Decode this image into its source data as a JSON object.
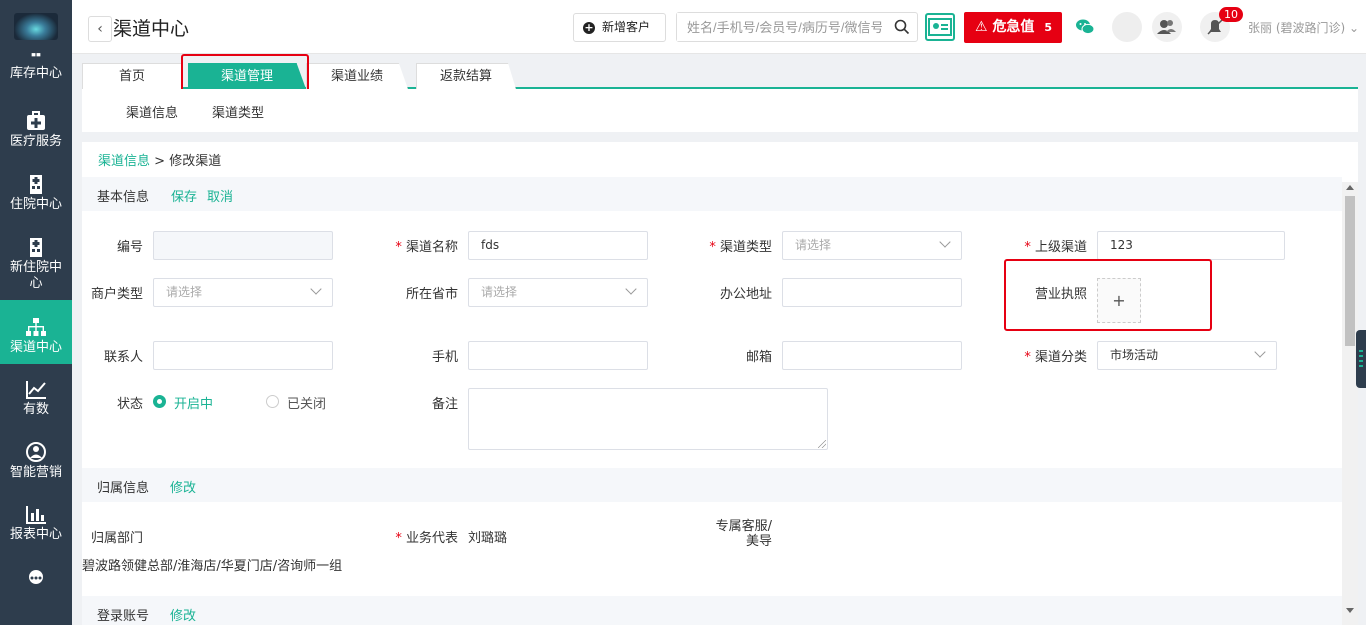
{
  "sidebar": {
    "items": [
      {
        "label": "库存中心"
      },
      {
        "label": "医疗服务"
      },
      {
        "label": "住院中心"
      },
      {
        "label": "新住院中心"
      },
      {
        "label": "渠道中心",
        "active": true
      },
      {
        "label": "有数"
      },
      {
        "label": "智能营销"
      },
      {
        "label": "报表中心"
      }
    ]
  },
  "header": {
    "back_icon": "‹",
    "title": "渠道中心",
    "new_customer_label": "新增客户",
    "search_placeholder": "姓名/手机号/会员号/病历号/微信号",
    "danger_label": "危急值",
    "danger_count": "5",
    "notification_count": "10",
    "user_name": "张丽 (碧波路门诊)"
  },
  "tabs": [
    {
      "label": "首页"
    },
    {
      "label": "渠道管理",
      "active": true
    },
    {
      "label": "渠道业绩"
    },
    {
      "label": "返款结算"
    }
  ],
  "subnav": [
    "渠道信息",
    "渠道类型"
  ],
  "breadcrumb": {
    "link": "渠道信息",
    "sep": ">",
    "current": "修改渠道"
  },
  "basic": {
    "title": "基本信息",
    "save": "保存",
    "cancel": "取消",
    "fields": {
      "code_label": "编号",
      "name_label": "渠道名称",
      "name_value": "fds",
      "type_label": "渠道类型",
      "type_placeholder": "请选择",
      "parent_label": "上级渠道",
      "parent_value": "123",
      "merchant_label": "商户类型",
      "merchant_placeholder": "请选择",
      "province_label": "所在省市",
      "province_placeholder": "请选择",
      "address_label": "办公地址",
      "license_label": "营业执照",
      "upload_plus": "+",
      "contact_label": "联系人",
      "mobile_label": "手机",
      "email_label": "邮箱",
      "category_label": "渠道分类",
      "category_value": "市场活动",
      "status_label": "状态",
      "status_on": "开启中",
      "status_off": "已关闭",
      "remark_label": "备注"
    }
  },
  "belong": {
    "title": "归属信息",
    "edit": "修改",
    "dept_label": "归属部门",
    "dept_value": "碧波路领健总部/淮海店/华夏门店/咨询师一组",
    "rep_label": "业务代表",
    "rep_value": "刘璐璐",
    "service_label_1": "专属客服/",
    "service_label_2": "美导"
  },
  "login": {
    "title": "登录账号",
    "edit": "修改"
  },
  "colors": {
    "accent": "#1ab394",
    "sidebar": "#2e3d4d",
    "danger": "#e60012"
  },
  "icons": [
    "inventory-icon",
    "medical-kit-icon",
    "hospital-icon",
    "new-hospital-icon",
    "channel-tree-icon",
    "trend-chart-icon",
    "marketing-icon",
    "report-icon",
    "more-icon",
    "search-icon",
    "id-card-icon",
    "wechat-icon",
    "group-icon",
    "bell-muted-icon"
  ]
}
